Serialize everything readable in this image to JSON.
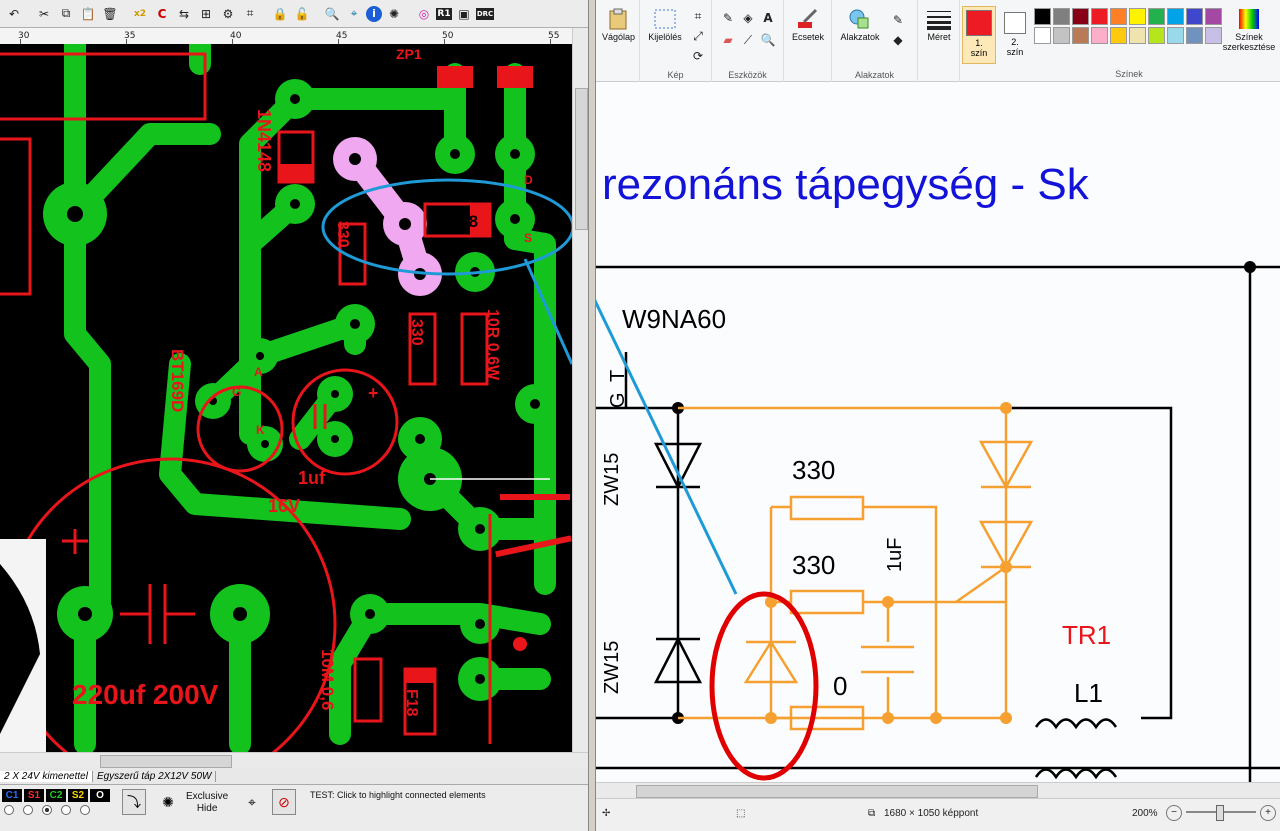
{
  "sprint": {
    "toolbar_icons": [
      "undo-icon",
      "cut-icon",
      "copy-icon",
      "paste-icon",
      "delete-icon",
      "zoom-x2-icon",
      "rotate-icon",
      "mirror-icon",
      "group-icon",
      "settings-icon",
      "connect-icon",
      "lock-icon",
      "unlock-icon",
      "search-icon",
      "crop-icon",
      "info-icon",
      "gear-icon",
      "circle-icon",
      "r1-icon",
      "screen-icon",
      "drc-icon"
    ],
    "toolbar_labels": {
      "zoom": "x2",
      "r1": "R1",
      "drc": "DRC"
    },
    "ruler_ticks": [
      "30",
      "35",
      "40",
      "45",
      "50",
      "55"
    ],
    "tabs": [
      "2 X 24V kimenettel",
      "Egyszerű táp  2X12V 50W"
    ],
    "layers": [
      {
        "label": "C1",
        "color": "#2b6dff"
      },
      {
        "label": "S1",
        "color": "#ff2b2b"
      },
      {
        "label": "C2",
        "color": "#22c722"
      },
      {
        "label": "S2",
        "color": "#ffd400"
      },
      {
        "label": "O",
        "color": "#ffffff"
      }
    ],
    "exclusive_hide": [
      "Exclusive",
      "Hide"
    ],
    "status_prefix": "TEST:",
    "status_text": "Click to highlight connected elements",
    "pcb_labels": {
      "n4148_top": "1N4148",
      "n4148_mid": "N4148",
      "r33_1": "330",
      "r33_2": "330",
      "r10": "10R 0,6W",
      "bt169": "BT169D",
      "cap_1uf": "1uf",
      "cap_16v": "16V",
      "cap_220": "220uf 200V",
      "r10m": "10M 0,6",
      "f18": "F18",
      "zp": "ZP1",
      "pin_a": "A",
      "pin_g": "G",
      "pin_k": "K",
      "pin_d": "D",
      "pin_s": "S",
      "plus": "+"
    }
  },
  "paint": {
    "groups": {
      "clipboard": {
        "label": "Vágólap"
      },
      "image": {
        "label": "Kép",
        "select": "Kijelölés"
      },
      "tools": {
        "label": "Eszközök"
      },
      "brushes": {
        "label": "Ecsetek"
      },
      "shapes": {
        "label": "Alakzatok",
        "btn": "Alakzatok"
      },
      "size": {
        "label": "Méret"
      },
      "colors": {
        "label": "Színek",
        "color1": [
          "1.",
          "szín"
        ],
        "color2": [
          "2.",
          "szín"
        ],
        "edit": [
          "Színek",
          "szerkesztése"
        ]
      }
    },
    "palette": [
      "#000000",
      "#7f7f7f",
      "#880015",
      "#ed1c24",
      "#ff7f27",
      "#fff200",
      "#22b14c",
      "#00a2e8",
      "#3f48cc",
      "#a349a4",
      "#ffffff",
      "#c3c3c3",
      "#b97a57",
      "#ffaec9",
      "#ffc90e",
      "#efe4b0",
      "#b5e61d",
      "#99d9ea",
      "#7092be",
      "#c8bfe7"
    ],
    "color1": "#ed1c24",
    "schematic": {
      "title": "rezonáns tápegység - Sk",
      "transistor": "W9NA60",
      "zener_top": "ZW15",
      "zener_bottom": "ZW15",
      "r_top": "330",
      "r_mid": "330",
      "cap": "1uF",
      "r_low": "0",
      "tr": "TR1",
      "l1": "L1",
      "pin_g": "G",
      "pin_t": "T"
    },
    "status": {
      "dimensions": "1680 × 1050 képpont",
      "zoom": "200%"
    }
  }
}
